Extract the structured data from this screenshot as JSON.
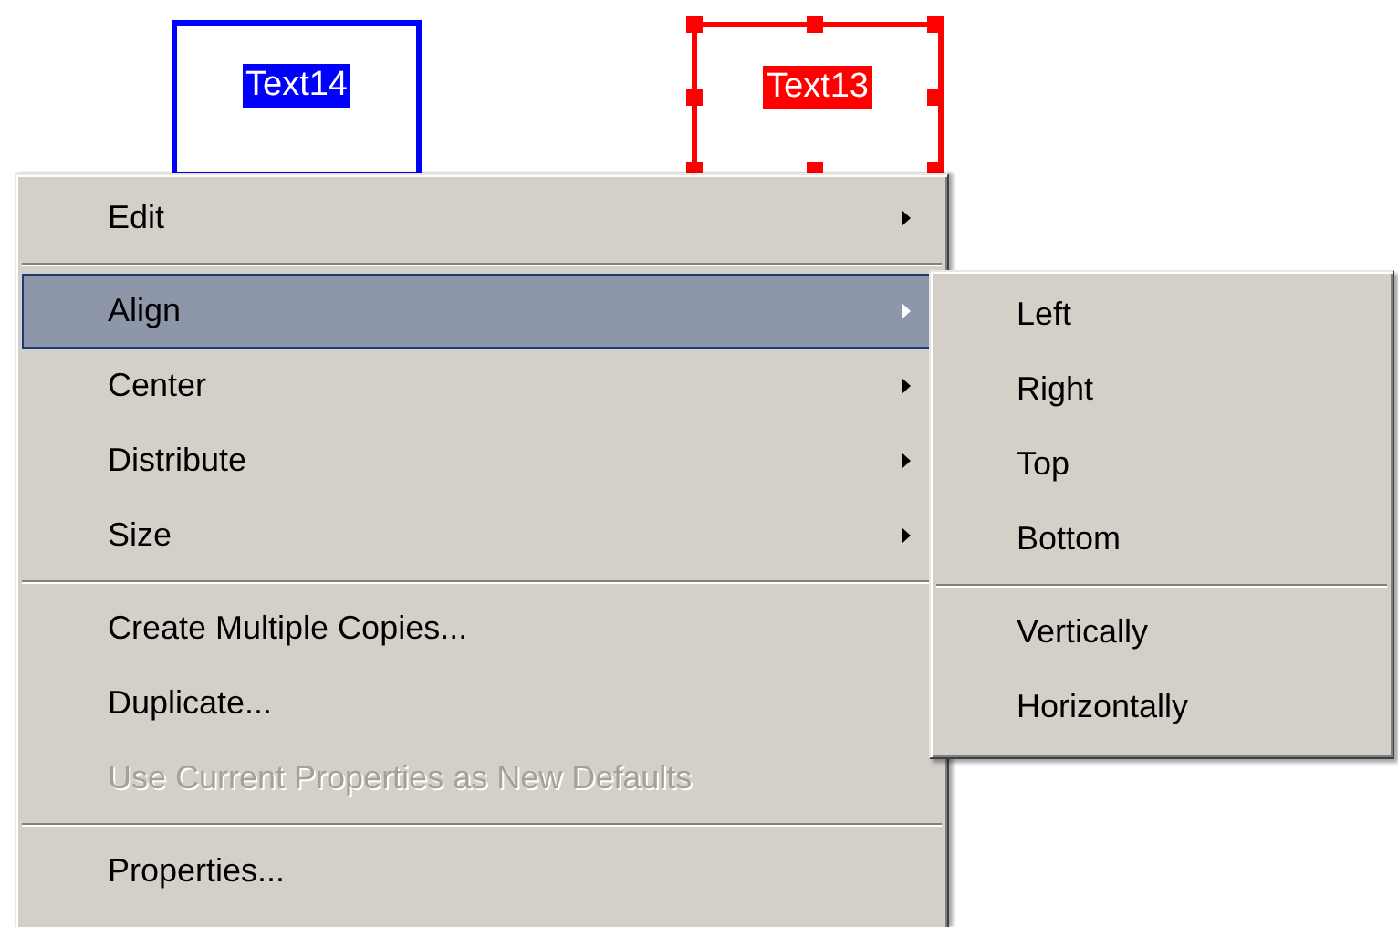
{
  "canvas_objects": [
    {
      "label": "Text14",
      "color": "#0000ff",
      "selected": false
    },
    {
      "label": "Text13",
      "color": "#ff0000",
      "selected": true
    }
  ],
  "context_menu": {
    "items": [
      {
        "kind": "item",
        "label": "Edit",
        "submenu": true,
        "selected": false,
        "disabled": false
      },
      {
        "kind": "separator"
      },
      {
        "kind": "item",
        "label": "Align",
        "submenu": true,
        "selected": true,
        "disabled": false
      },
      {
        "kind": "item",
        "label": "Center",
        "submenu": true,
        "selected": false,
        "disabled": false
      },
      {
        "kind": "item",
        "label": "Distribute",
        "submenu": true,
        "selected": false,
        "disabled": false
      },
      {
        "kind": "item",
        "label": "Size",
        "submenu": true,
        "selected": false,
        "disabled": false
      },
      {
        "kind": "separator"
      },
      {
        "kind": "item",
        "label": "Create Multiple Copies...",
        "submenu": false,
        "selected": false,
        "disabled": false
      },
      {
        "kind": "item",
        "label": "Duplicate...",
        "submenu": false,
        "selected": false,
        "disabled": false
      },
      {
        "kind": "item",
        "label": "Use Current Properties as New Defaults",
        "submenu": false,
        "selected": false,
        "disabled": true
      },
      {
        "kind": "separator"
      },
      {
        "kind": "item",
        "label": "Properties...",
        "submenu": false,
        "selected": false,
        "disabled": false
      }
    ]
  },
  "submenu": {
    "items": [
      {
        "kind": "item",
        "label": "Left",
        "submenu": false,
        "selected": false,
        "disabled": false
      },
      {
        "kind": "item",
        "label": "Right",
        "submenu": false,
        "selected": false,
        "disabled": false
      },
      {
        "kind": "item",
        "label": "Top",
        "submenu": false,
        "selected": false,
        "disabled": false
      },
      {
        "kind": "item",
        "label": "Bottom",
        "submenu": false,
        "selected": false,
        "disabled": false
      },
      {
        "kind": "separator"
      },
      {
        "kind": "item",
        "label": "Vertically",
        "submenu": false,
        "selected": false,
        "disabled": false
      },
      {
        "kind": "item",
        "label": "Horizontally",
        "submenu": false,
        "selected": false,
        "disabled": false
      }
    ]
  }
}
